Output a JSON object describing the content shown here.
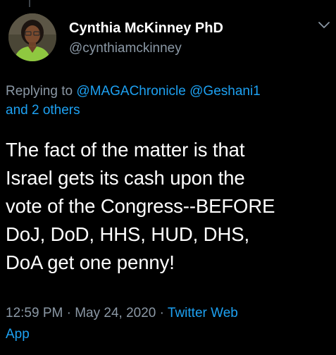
{
  "colors": {
    "background": "#000000",
    "primary_text": "#ffffff",
    "secondary_text": "#8b98a5",
    "link": "#1da1f2"
  },
  "author": {
    "name": "Cynthia McKinney PhD",
    "handle": "@cynthiamckinney",
    "avatar_icon": "profile-photo"
  },
  "menu": {
    "icon": "chevron-down-icon"
  },
  "reply": {
    "prefix": "Replying to",
    "mentions": [
      "@MAGAChronicle",
      "@Geshani1"
    ],
    "others": "and 2 others"
  },
  "tweet": {
    "lines": [
      "The fact of the matter is that",
      "Israel gets its cash upon the",
      "vote of the Congress--BEFORE",
      "DoJ, DoD, HHS, HUD, DHS,",
      "DoA get one penny!"
    ]
  },
  "meta": {
    "time": "12:59 PM",
    "separator": "·",
    "date": "May 24, 2020",
    "source_line1": "Twitter Web",
    "source_line2": "App"
  }
}
